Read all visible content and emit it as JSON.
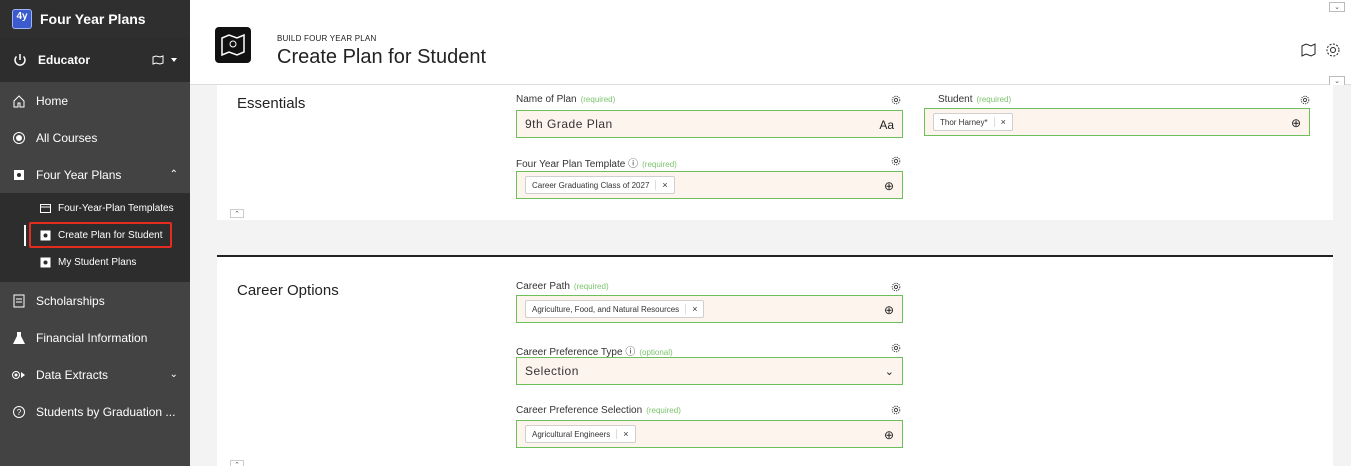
{
  "app": {
    "logo_text": "4y",
    "title": "Four Year Plans"
  },
  "role": {
    "label": "Educator"
  },
  "nav": {
    "home": "Home",
    "all_courses": "All Courses",
    "four_year_plans": "Four Year Plans",
    "sub_templates": "Four-Year-Plan Templates",
    "sub_create": "Create Plan for Student",
    "sub_my_plans": "My Student Plans",
    "scholarships": "Scholarships",
    "financial": "Financial Information",
    "data_extracts": "Data Extracts",
    "students_by_grad": "Students by Graduation ..."
  },
  "header": {
    "breadcrumb": "BUILD FOUR YEAR PLAN",
    "title": "Create Plan for Student"
  },
  "essentials": {
    "title": "Essentials",
    "name_label": "Name of Plan",
    "name_req": "(required)",
    "name_value": "9th Grade Plan",
    "name_suffix": "Aa",
    "student_label": "Student",
    "student_req": "(required)",
    "student_chip": "Thor Harney*",
    "template_label": "Four Year Plan Template",
    "template_req": "(required)",
    "template_chip": "Career Graduating Class of 2027"
  },
  "career": {
    "title": "Career Options",
    "path_label": "Career Path",
    "path_req": "(required)",
    "path_chip": "Agriculture, Food, and Natural Resources",
    "pref_type_label": "Career Preference Type",
    "pref_type_req": "(optional)",
    "pref_type_value": "Selection",
    "pref_sel_label": "Career Preference Selection",
    "pref_sel_req": "(required)",
    "pref_sel_chip": "Agricultural Engineers"
  },
  "chip_remove": "×",
  "colors": {
    "sidebar": "#2d2d2d",
    "field_border": "#6cbf5a",
    "field_bg": "#fdf4ee",
    "highlight": "#e52b20"
  }
}
